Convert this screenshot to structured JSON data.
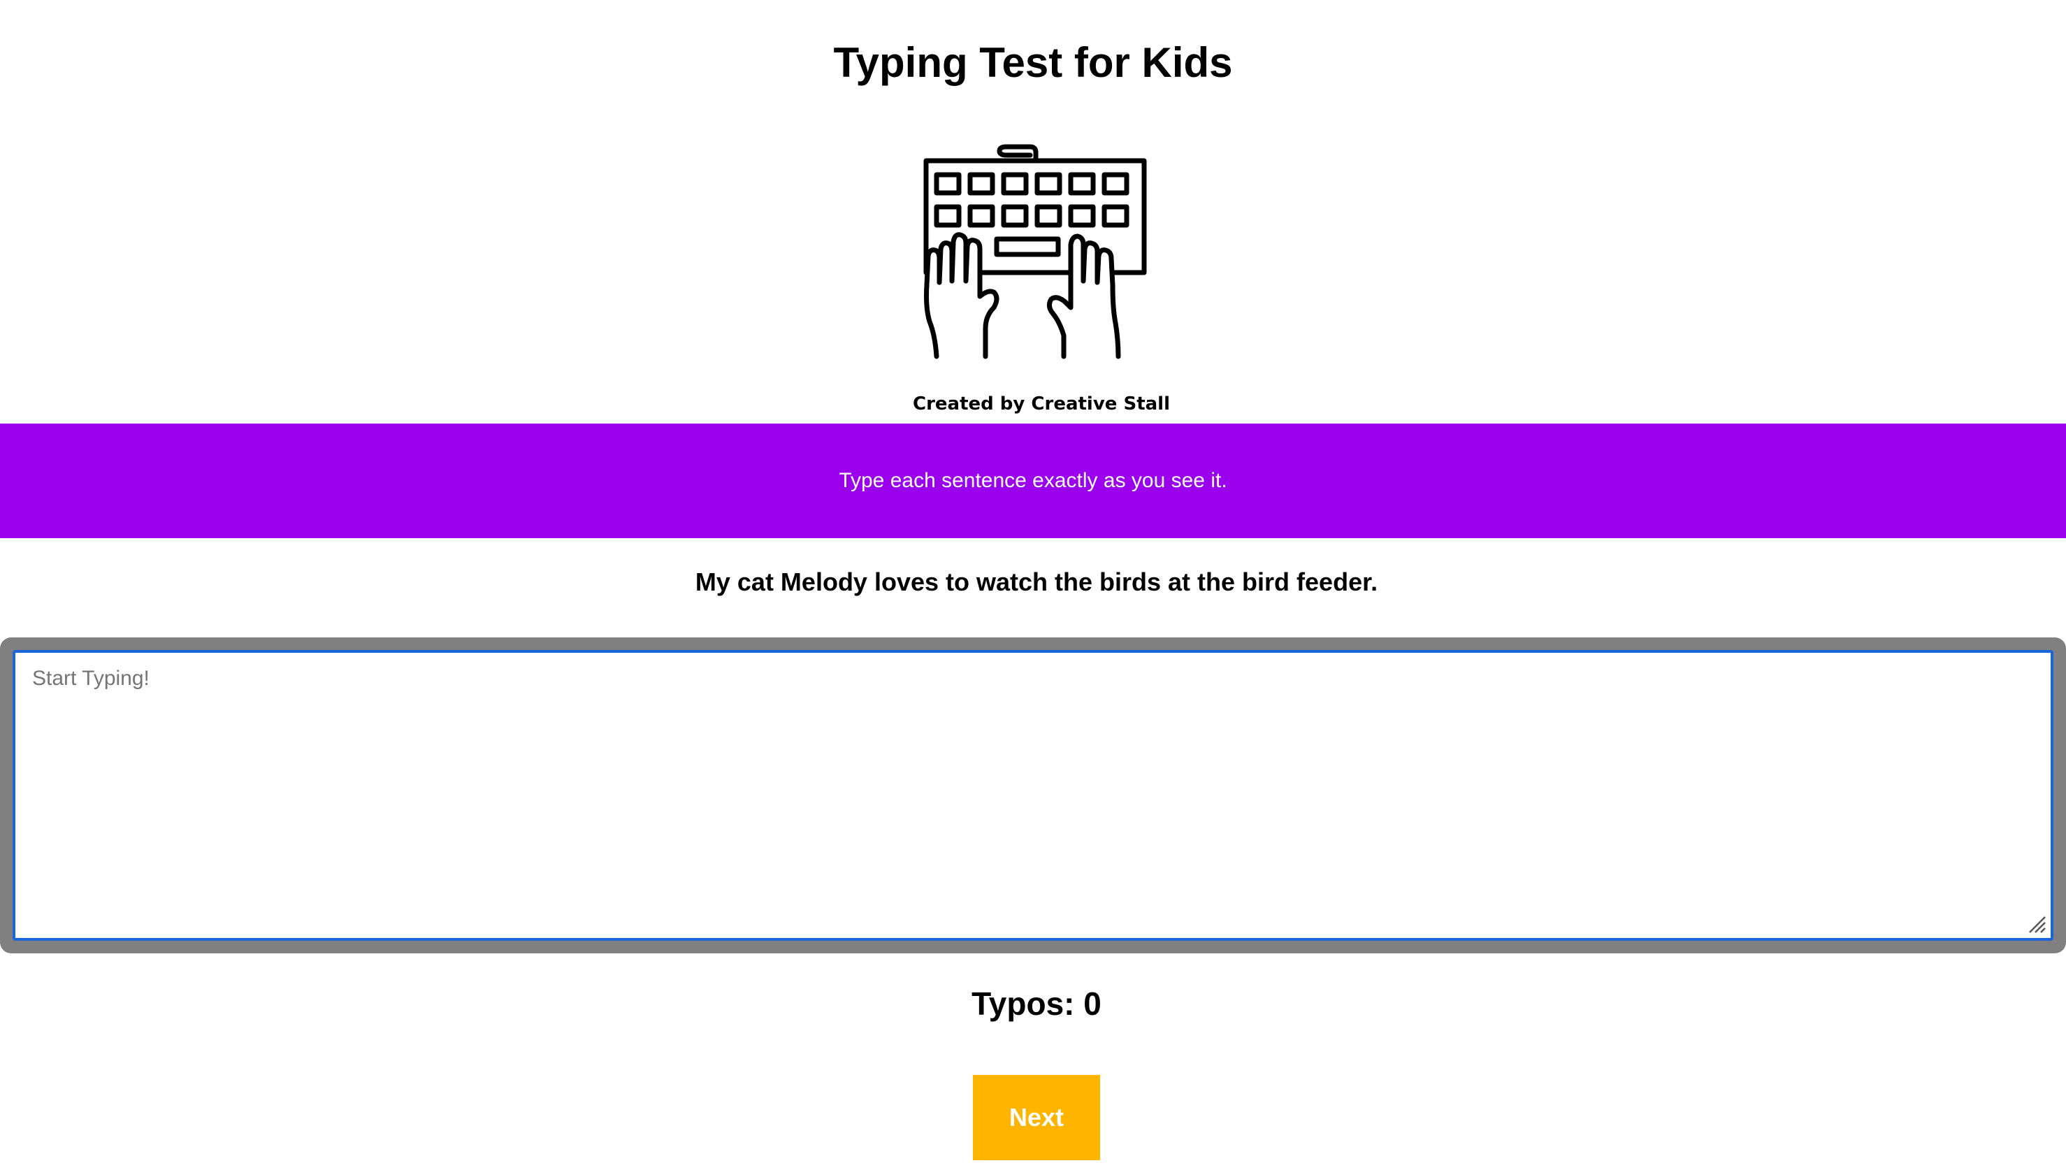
{
  "header": {
    "title": "Typing Test for Kids",
    "illustration_icon": "keyboard-hands-icon",
    "credit": "Created by Creative Stall"
  },
  "instructions": {
    "text": "Type each sentence exactly as you see it.",
    "background_color": "#9b00ee"
  },
  "prompt": {
    "sentence": "My cat Melody loves to watch the birds at the bird feeder."
  },
  "typing_input": {
    "value": "",
    "placeholder": "Start Typing!"
  },
  "stats": {
    "typos_label": "Typos: 0"
  },
  "controls": {
    "next_label": "Next",
    "next_color": "#ffb400"
  }
}
